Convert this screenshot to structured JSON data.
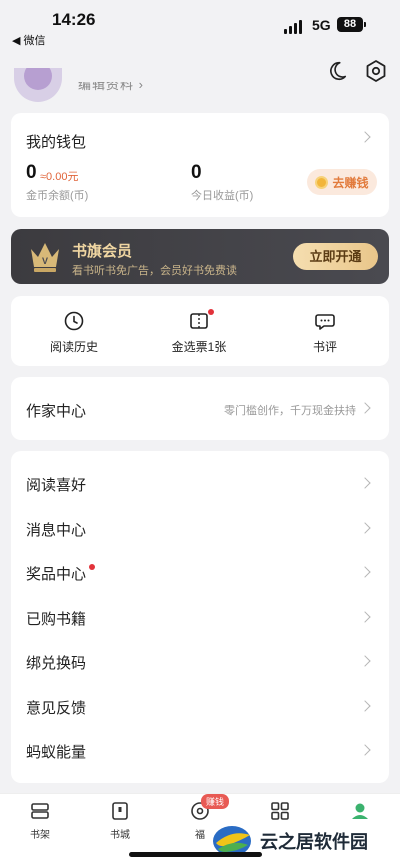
{
  "status_bar": {
    "time": "14:26",
    "back_app": "◀ 微信",
    "network": "5G",
    "battery": "88"
  },
  "profile": {
    "username": "编辑资料 ›"
  },
  "wallet": {
    "title": "我的钱包",
    "coin_value": "0",
    "coin_rmb": "≈0.00元",
    "coin_label": "金币余额(币)",
    "today_value": "0",
    "today_label": "今日收益(币)",
    "earn_button": "去赚钱"
  },
  "vip": {
    "title": "书旗会员",
    "subtitle": "看书听书免广告，会员好书免费读",
    "button": "立即开通"
  },
  "quick_actions": [
    {
      "label": "阅读历史",
      "icon": "clock-icon"
    },
    {
      "label": "金选票1张",
      "icon": "ticket-icon",
      "has_dot": true
    },
    {
      "label": "书评",
      "icon": "comment-icon"
    }
  ],
  "author_center": {
    "title": "作家中心",
    "subtitle": "零门槛创作，千万现金扶持"
  },
  "menu_items": [
    {
      "label": "阅读喜好"
    },
    {
      "label": "消息中心"
    },
    {
      "label": "奖品中心",
      "has_dot": true
    },
    {
      "label": "已购书籍"
    },
    {
      "label": "绑兑换码"
    },
    {
      "label": "意见反馈"
    },
    {
      "label": "蚂蚁能量"
    }
  ],
  "tabbar": {
    "items": [
      {
        "label": "书架",
        "icon": "bookshelf-icon"
      },
      {
        "label": "书城",
        "icon": "bookstore-icon"
      },
      {
        "label": "福",
        "icon": "welfare-icon"
      },
      {
        "label": "",
        "icon": "category-icon"
      },
      {
        "label": "",
        "icon": "profile-icon"
      }
    ],
    "badge": "赚钱"
  },
  "watermark": {
    "text": "云之居软件园"
  },
  "colors": {
    "accent": "#e27b3c",
    "vip_gold": "#f0d6a2",
    "active_tab": "#3bb26e",
    "red_dot": "#e2323a"
  }
}
